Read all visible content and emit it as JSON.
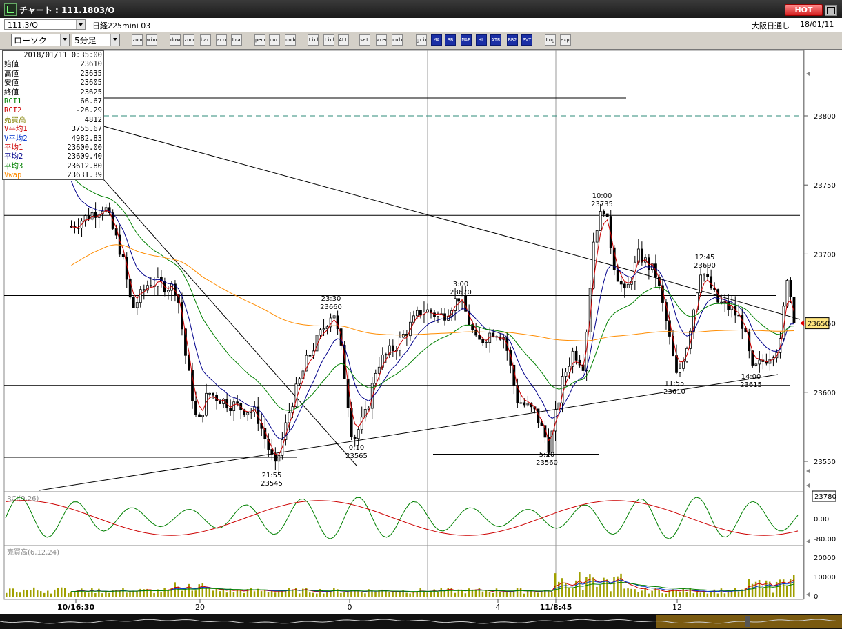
{
  "window": {
    "title": "チャート : 111.1803/O",
    "hot_label": "HOT"
  },
  "infobar": {
    "symbol": "111.3/O",
    "instrument": "日経225mini 03",
    "market": "大阪日通し",
    "date": "18/01/11"
  },
  "toolbar": {
    "chart_type": "ローソク",
    "interval": "5分足",
    "buttons": [
      "zoom",
      "window",
      "down",
      "zoom-magnify",
      "bars",
      "arrows",
      "trash",
      "pencil",
      "cursor",
      "undo",
      "ticks",
      "ticks2",
      "ALL",
      "settings",
      "wrench",
      "color",
      "grid",
      "MA",
      "BB",
      "MAE",
      "HL",
      "ATR",
      "BB2",
      "PVT",
      "Log",
      "export"
    ]
  },
  "legend": {
    "datetime": "2018/01/11 0:35:00",
    "rows": [
      {
        "label": "始値",
        "value": "23610",
        "color": "#000000"
      },
      {
        "label": "高値",
        "value": "23635",
        "color": "#000000"
      },
      {
        "label": "安値",
        "value": "23605",
        "color": "#000000"
      },
      {
        "label": "終値",
        "value": "23625",
        "color": "#000000"
      },
      {
        "label": "RCI1",
        "value": "66.67",
        "color": "#008000"
      },
      {
        "label": "RCI2",
        "value": "-26.29",
        "color": "#cc0000"
      },
      {
        "label": "売買高",
        "value": "4812",
        "color": "#808000"
      },
      {
        "label": "V平均1",
        "value": "3755.67",
        "color": "#cc0000"
      },
      {
        "label": "V平均2",
        "value": "4982.83",
        "color": "#0033cc"
      },
      {
        "label": "平均1",
        "value": "23600.00",
        "color": "#cc0000"
      },
      {
        "label": "平均2",
        "value": "23609.40",
        "color": "#00008b"
      },
      {
        "label": "平均3",
        "value": "23612.80",
        "color": "#008000"
      },
      {
        "label": "Vwap",
        "value": "23631.39",
        "color": "#ff8c00"
      }
    ]
  },
  "chart_data": {
    "type": "candlestick",
    "price_axis": {
      "ticks": [
        "23800",
        "23750",
        "23700",
        "23650",
        "23600",
        "23550"
      ],
      "current_price": "23650",
      "range": [
        23535,
        23850
      ]
    },
    "time_axis": {
      "labels": [
        "10/16:30",
        "20",
        "0",
        "4",
        "11/8:45",
        "12"
      ]
    },
    "annotations": [
      {
        "time": "21:55",
        "price": "23545"
      },
      {
        "time": "0:10",
        "price": "23565"
      },
      {
        "time": "23:30",
        "price": "23660"
      },
      {
        "time": "3:00",
        "price": "23670"
      },
      {
        "time": "5:20",
        "price": "23560"
      },
      {
        "time": "10:00",
        "price": "23735"
      },
      {
        "time": "11:55",
        "price": "23610"
      },
      {
        "time": "12:45",
        "price": "23690"
      },
      {
        "time": "14:00",
        "price": "23615"
      }
    ],
    "horizontal_lines": [
      {
        "price": 23813,
        "style": "solid"
      },
      {
        "price": 23800,
        "style": "dashed",
        "color": "#2e8b7a"
      },
      {
        "price": 23728,
        "style": "solid"
      },
      {
        "price": 23670,
        "style": "solid"
      },
      {
        "price": 23605,
        "style": "solid"
      },
      {
        "price": 23553,
        "style": "solid"
      },
      {
        "price": 23555,
        "style": "solid-thick"
      }
    ],
    "series": [
      {
        "name": "平均1",
        "color": "#cc0000"
      },
      {
        "name": "平均2",
        "color": "#00008b"
      },
      {
        "name": "平均3",
        "color": "#008000"
      },
      {
        "name": "Vwap",
        "color": "#ff8c00"
      }
    ],
    "rci_panel": {
      "label": "RCI(9,26)",
      "ticks": [
        "0.00",
        "-80.00"
      ],
      "value_box": "23780"
    },
    "volume_panel": {
      "label": "売買高(6,12,24)",
      "ticks": [
        "20000",
        "10000",
        "0"
      ]
    }
  }
}
